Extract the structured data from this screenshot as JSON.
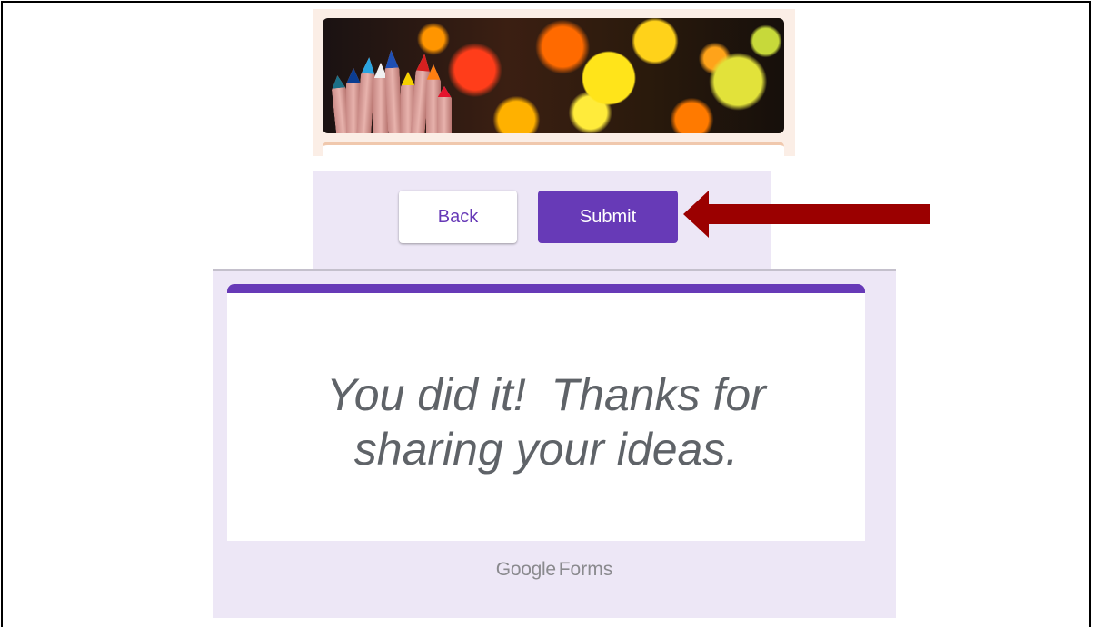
{
  "navigation": {
    "back_label": "Back",
    "submit_label": "Submit"
  },
  "confirmation": {
    "line1": "You did it!  Thanks for",
    "line2": "sharing your ideas."
  },
  "footer": {
    "brand_part1": "Google",
    "brand_part2": "Forms"
  },
  "colors": {
    "accent": "#673ab7",
    "band_background": "#ede7f6",
    "arrow": "#9b0000",
    "header_panel": "#fbeee6"
  },
  "icons": {
    "arrow": "left-arrow-icon",
    "header_image": "colored-pencils-bokeh-image"
  }
}
